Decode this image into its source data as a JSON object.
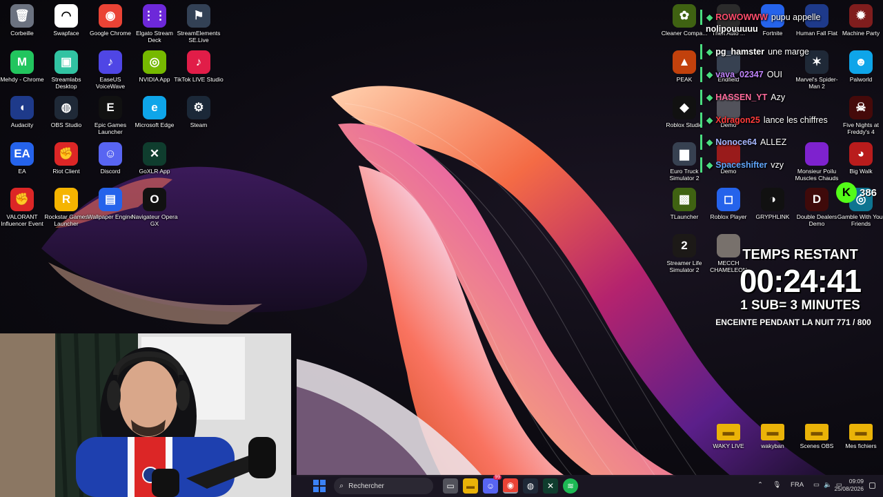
{
  "desktop_icons": [
    {
      "label": "Corbeille",
      "icon": "recycle-bin-icon",
      "color": "#6b7280",
      "glyph": "🗑"
    },
    {
      "label": "Swapface",
      "icon": "swapface-icon",
      "color": "#ffffff",
      "glyph": "◠"
    },
    {
      "label": "Google Chrome",
      "icon": "chrome-icon",
      "color": "#ea4335",
      "glyph": "◉"
    },
    {
      "label": "Elgato Stream Deck",
      "icon": "stream-deck-icon",
      "color": "#6d28d9",
      "glyph": "⋮⋮"
    },
    {
      "label": "StreamElements SE.Live",
      "icon": "streamelements-icon",
      "color": "#334155",
      "glyph": "⚑"
    },
    {
      "label": "Mehdy - Chrome",
      "icon": "chrome-profile-icon",
      "color": "#22c55e",
      "glyph": "M"
    },
    {
      "label": "Streamlabs Desktop",
      "icon": "streamlabs-icon",
      "color": "#31c3a2",
      "glyph": "▣"
    },
    {
      "label": "EaseUS VoiceWave",
      "icon": "voicewave-icon",
      "color": "#4f46e5",
      "glyph": "♪"
    },
    {
      "label": "NVIDIA App",
      "icon": "nvidia-icon",
      "color": "#76b900",
      "glyph": "◎"
    },
    {
      "label": "TikTok LIVE Studio",
      "icon": "tiktok-icon",
      "color": "#e11d48",
      "glyph": "♪"
    },
    {
      "label": "Audacity",
      "icon": "audacity-icon",
      "color": "#1e3a8a",
      "glyph": "◖"
    },
    {
      "label": "OBS Studio",
      "icon": "obs-icon",
      "color": "#1f2937",
      "glyph": "◍"
    },
    {
      "label": "Epic Games Launcher",
      "icon": "epic-games-icon",
      "color": "#111111",
      "glyph": "E"
    },
    {
      "label": "Microsoft Edge",
      "icon": "edge-icon",
      "color": "#0ea5e9",
      "glyph": "e"
    },
    {
      "label": "Steam",
      "icon": "steam-icon",
      "color": "#1b2838",
      "glyph": "⚙"
    },
    {
      "label": "EA",
      "icon": "ea-icon",
      "color": "#2563eb",
      "glyph": "EA"
    },
    {
      "label": "Riot Client",
      "icon": "riot-client-icon",
      "color": "#dc2626",
      "glyph": "✊"
    },
    {
      "label": "Discord",
      "icon": "discord-icon",
      "color": "#5865f2",
      "glyph": "☺"
    },
    {
      "label": "GoXLR App",
      "icon": "goxlr-icon",
      "color": "#0f3d2e",
      "glyph": "✕"
    },
    {
      "label": "VALORANT Influencer Event",
      "icon": "valorant-icon",
      "color": "#dc2626",
      "glyph": "✊"
    },
    {
      "label": "Rockstar Games Launcher",
      "icon": "rockstar-icon",
      "color": "#f5b400",
      "glyph": "R"
    },
    {
      "label": "Wallpaper Engine",
      "icon": "wallpaper-engine-icon",
      "color": "#2563eb",
      "glyph": "▤"
    },
    {
      "label": "Navigateur Opera GX",
      "icon": "opera-gx-icon",
      "color": "#111111",
      "glyph": "O"
    }
  ],
  "right_icons": [
    {
      "label": "Cleaner Compa...",
      "icon": "cleaner-icon",
      "color": "#3f6212",
      "glyph": "✿"
    },
    {
      "label": "Theft Auto ...",
      "icon": "gta-icon",
      "color": "#2b2b2b",
      "glyph": ""
    },
    {
      "label": "Fortnite",
      "icon": "fortnite-icon",
      "color": "#2563eb",
      "glyph": ""
    },
    {
      "label": "Human Fall Flat",
      "icon": "human-fall-flat-icon",
      "color": "#1e3a8a",
      "glyph": ""
    },
    {
      "label": "Machine Party",
      "icon": "machine-party-icon",
      "color": "#7f1d1d",
      "glyph": "✹"
    },
    {
      "label": "PEAK",
      "icon": "peak-icon",
      "color": "#c2410c",
      "glyph": "▲"
    },
    {
      "label": "Endfield",
      "icon": "endfield-icon",
      "color": "#374151",
      "glyph": ""
    },
    {
      "label": "Marvel's Spider-Man 2",
      "icon": "spiderman-icon",
      "color": "#1f2937",
      "glyph": "✶"
    },
    {
      "label": "Palworld",
      "icon": "palworld-icon",
      "color": "#0ea5e9",
      "glyph": "☻"
    },
    {
      "label": "Roblox Studio",
      "icon": "roblox-studio-icon",
      "color": "#111111",
      "glyph": "◆"
    },
    {
      "label": "Demo",
      "icon": "demo-icon",
      "color": "#52525b",
      "glyph": ""
    },
    {
      "label": "Five Nights at Freddy's 4",
      "icon": "fnaf-icon",
      "color": "#450a0a",
      "glyph": "☠"
    },
    {
      "label": "Euro Truck Simulator 2",
      "icon": "euro-truck-icon",
      "color": "#374151",
      "glyph": "▆"
    },
    {
      "label": "Demo",
      "icon": "demo-icon-2",
      "color": "#991b1b",
      "glyph": ""
    },
    {
      "label": "Monsieur Poilu Muscles Chauds",
      "icon": "monsieur-poilu-icon",
      "color": "#7e22ce",
      "glyph": ""
    },
    {
      "label": "Big Walk",
      "icon": "big-walk-icon",
      "color": "#b91c1c",
      "glyph": "◕"
    },
    {
      "label": "TLauncher",
      "icon": "tlauncher-icon",
      "color": "#3f6212",
      "glyph": "▩"
    },
    {
      "label": "Roblox Player",
      "icon": "roblox-player-icon",
      "color": "#2563eb",
      "glyph": "◻"
    },
    {
      "label": "GRYPHLINK",
      "icon": "gryphlink-icon",
      "color": "#111111",
      "glyph": "◑"
    },
    {
      "label": "Double Dealers Demo",
      "icon": "double-dealers-icon",
      "color": "#3f0a0a",
      "glyph": "D"
    },
    {
      "label": "Gamble With Your Friends",
      "icon": "gamble-icon",
      "color": "#0e7490",
      "glyph": "◎"
    },
    {
      "label": "Streamer Life Simulator 2",
      "icon": "streamer-life-icon",
      "color": "#1c1917",
      "glyph": "2"
    },
    {
      "label": "MECCH CHAMELEON",
      "icon": "chameleon-icon",
      "color": "#78716c",
      "glyph": ""
    },
    {
      "label": "WAKY LIVE",
      "icon": "folder-icon",
      "color": "#eab308",
      "glyph": "▬"
    },
    {
      "label": "wakyban",
      "icon": "folder-icon",
      "color": "#eab308",
      "glyph": "▬"
    },
    {
      "label": "Scenes OBS",
      "icon": "folder-icon",
      "color": "#eab308",
      "glyph": "▬"
    },
    {
      "label": "Mes fichiers",
      "icon": "folder-icon",
      "color": "#eab308",
      "glyph": "▬"
    }
  ],
  "chat": [
    {
      "user": "ROWOWWW",
      "msg": "pupu appelle",
      "color": "#ff4d6d"
    },
    {
      "user": "",
      "msg": "nolipouuuuu",
      "color": "#ffffff"
    },
    {
      "user": "pg_hamster",
      "msg": "une marge",
      "color": "#ffffff"
    },
    {
      "user": "vava_02347",
      "msg": "OUI",
      "color": "#c084fc"
    },
    {
      "user": "HASSEN_YT",
      "msg": "Azy",
      "color": "#ff6b9d"
    },
    {
      "user": "Xdragon25",
      "msg": "lance les chiffres",
      "color": "#ff3b3b"
    },
    {
      "user": "Nonoce64",
      "msg": "ALLEZ",
      "color": "#a5b4fc"
    },
    {
      "user": "Spaceshifter",
      "msg": "vzy",
      "color": "#60a5fa"
    }
  ],
  "kick": {
    "count": "386"
  },
  "timer": {
    "title": "TEMPS RESTANT",
    "clock": "00:24:41",
    "rule": "1 SUB= 3 MINUTES",
    "goal": "ENCEINTE PENDANT LA NUIT 771 / 800"
  },
  "taskbar": {
    "search_placeholder": "Rechercher",
    "language": "FRA",
    "time": "09:09",
    "date": "25/08/2026",
    "discord_badge": "99"
  }
}
